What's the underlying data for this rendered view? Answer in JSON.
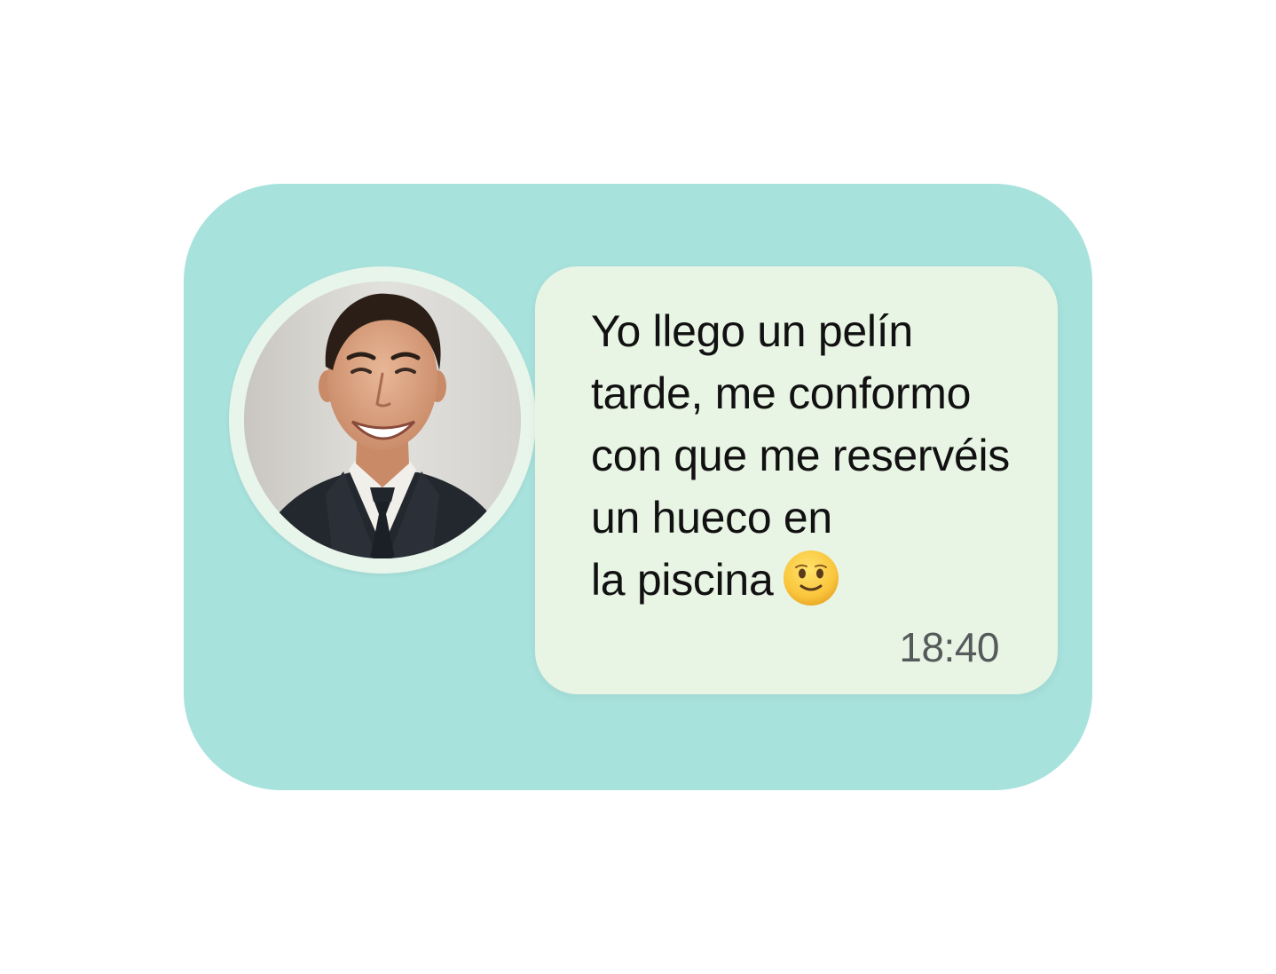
{
  "conversation": {
    "contact": {
      "avatar_alt": "",
      "avatar_icon": "avatar-photo"
    },
    "message": {
      "text": "Yo llego un pelín\ntarde, me conformo\ncon que me reservéis\nun hueco en\nla piscina",
      "emoji": "slightly-smiling-face",
      "time": "18:40"
    }
  },
  "colors": {
    "card_background": "#a8e2dd",
    "bubble_background": "#e8f4e4",
    "avatar_ring": "#e7f5ea",
    "timestamp_text": "#555a5a"
  }
}
